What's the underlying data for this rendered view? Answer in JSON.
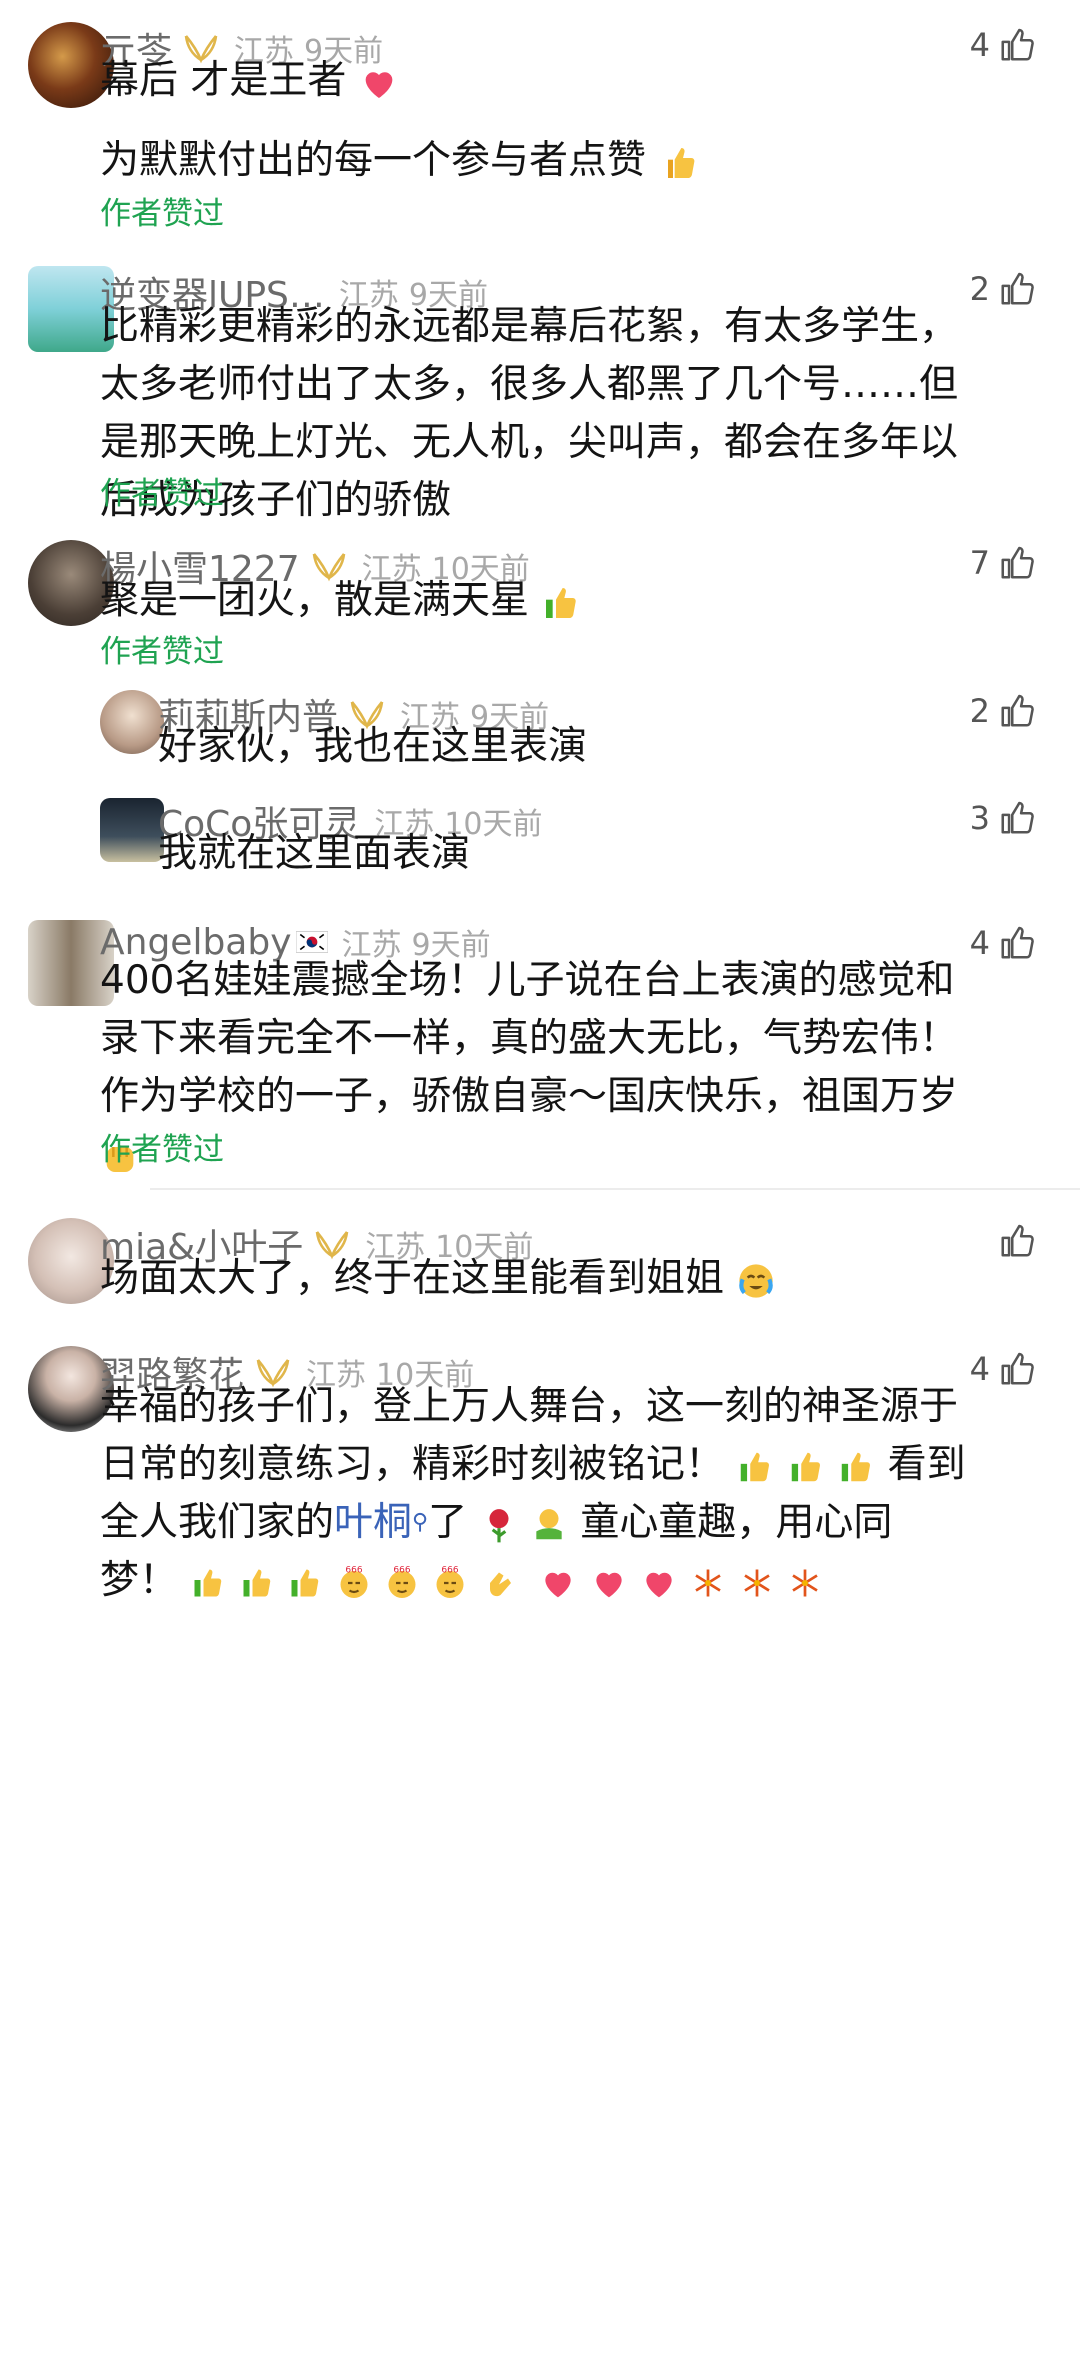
{
  "comments": [
    {
      "name": "亓苓",
      "location": "江苏",
      "time": "9天前",
      "likes": "4",
      "text1": "幕后 才是王者",
      "text2": "为默默付出的每一个参与者点赞",
      "author_liked": "作者赞过"
    },
    {
      "name": "逆变器lUPS…",
      "location": "江苏",
      "time": "9天前",
      "likes": "2",
      "lines": [
        "比精彩更精彩的永远都是幕后花絮，有太多学生，",
        "太多老师付出了太多，很多人都黑了几个号……但",
        "是那天晚上灯光、无人机，尖叫声，都会在多年以",
        "后成为孩子们的骄傲"
      ],
      "author_liked": "作者赞过"
    },
    {
      "name": "楊小雪1227",
      "location": "江苏",
      "time": "10天前",
      "likes": "7",
      "text": "聚是一团火，散是满天星",
      "author_liked": "作者赞过",
      "replies": [
        {
          "name": "莉莉斯内普",
          "location": "江苏",
          "time": "9天前",
          "likes": "2",
          "text": "好家伙，我也在这里表演"
        },
        {
          "name": "CoCo张可灵",
          "location": "江苏",
          "time": "10天前",
          "likes": "3",
          "text": "我就在这里面表演"
        }
      ]
    },
    {
      "name": "Angelbaby",
      "location": "江苏",
      "time": "9天前",
      "likes": "4",
      "lines": [
        "400名娃娃震撼全场！儿子说在台上表演的感觉和",
        "录下来看完全不一样，真的盛大无比，气势宏伟！",
        "作为学校的一子，骄傲自豪～国庆快乐，祖国万岁"
      ],
      "author_liked": "作者赞过"
    },
    {
      "name": "mia&小叶子",
      "location": "江苏",
      "time": "10天前",
      "likes": "",
      "text": "场面太大了，终于在这里能看到姐姐"
    },
    {
      "name": "羿路繁花",
      "location": "江苏",
      "time": "10天前",
      "likes": "4",
      "line1": "幸福的孩子们，登上万人舞台，这一刻的神圣源于",
      "line2": "日常的刻意练习，精彩时刻被铭记！",
      "line2b": "看到",
      "line3a": "全人我们家的",
      "line3link": "叶桐",
      "line3b": "了",
      "line3c": "童心童趣，用心同",
      "line4": "梦！"
    }
  ],
  "colors": {
    "accent_green": "#1fa351",
    "link_blue": "#3a63b8",
    "badge_gold": "#e0b64a"
  }
}
